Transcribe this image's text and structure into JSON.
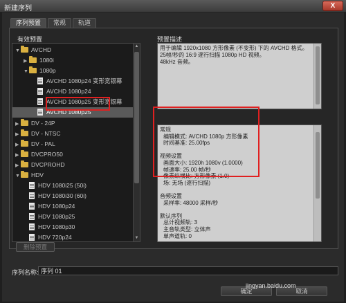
{
  "window": {
    "title": "新建序列",
    "close_label": "X"
  },
  "tabs": [
    {
      "label": "序列预置",
      "active": true
    },
    {
      "label": "常规",
      "active": false
    },
    {
      "label": "轨道",
      "active": false
    }
  ],
  "presets": {
    "heading": "有效预置",
    "items": [
      {
        "label": "AVCHD",
        "type": "folder",
        "expanded": true,
        "level": 0
      },
      {
        "label": "1080i",
        "type": "folder",
        "expanded": false,
        "level": 1
      },
      {
        "label": "1080p",
        "type": "folder",
        "expanded": true,
        "level": 1
      },
      {
        "label": "AVCHD 1080p24 变形宽银幕",
        "type": "file",
        "level": 2
      },
      {
        "label": "AVCHD 1080p24",
        "type": "file",
        "level": 2
      },
      {
        "label": "AVCHD 1080p25 变形宽银幕",
        "type": "file",
        "level": 2
      },
      {
        "label": "AVCHD 1080p25",
        "type": "file",
        "level": 2,
        "selected": true
      },
      {
        "label": "DV - 24P",
        "type": "folder",
        "expanded": false,
        "level": 0
      },
      {
        "label": "DV - NTSC",
        "type": "folder",
        "expanded": false,
        "level": 0
      },
      {
        "label": "DV - PAL",
        "type": "folder",
        "expanded": false,
        "level": 0
      },
      {
        "label": "DVCPRO50",
        "type": "folder",
        "expanded": false,
        "level": 0
      },
      {
        "label": "DVCPROHD",
        "type": "folder",
        "expanded": false,
        "level": 0
      },
      {
        "label": "HDV",
        "type": "folder",
        "expanded": true,
        "level": 0
      },
      {
        "label": "HDV 1080i25 (50i)",
        "type": "file",
        "level": 1
      },
      {
        "label": "HDV 1080i30 (60i)",
        "type": "file",
        "level": 1
      },
      {
        "label": "HDV 1080p24",
        "type": "file",
        "level": 1
      },
      {
        "label": "HDV 1080p25",
        "type": "file",
        "level": 1
      },
      {
        "label": "HDV 1080p30",
        "type": "file",
        "level": 1
      },
      {
        "label": "HDV 720p24",
        "type": "file",
        "level": 1
      }
    ]
  },
  "description": {
    "heading": "预置描述",
    "lines": [
      "用于编辑 1920x1080 方形像素 (不变形) 下的 AVCHD 格式。",
      "25帧/秒的 16:9 逐行扫描 1080p HD 视频。",
      "48kHz 音频。"
    ]
  },
  "details": {
    "lines": [
      {
        "text": "常规",
        "indent": false
      },
      {
        "text": "编辑模式: AVCHD 1080p 方形像素",
        "indent": true
      },
      {
        "text": "时间基准: 25.00fps",
        "indent": true
      },
      {
        "text": "",
        "indent": false
      },
      {
        "text": "视频设置",
        "indent": false
      },
      {
        "text": "画面大小: 1920h 1080v (1.0000)",
        "indent": true
      },
      {
        "text": "帧速率: 25.00 帧/秒",
        "indent": true
      },
      {
        "text": "像素纵横比: 方形像素 (1.0)",
        "indent": true
      },
      {
        "text": "场: 无场 (逐行扫描)",
        "indent": true
      },
      {
        "text": "",
        "indent": false
      },
      {
        "text": "音频设置",
        "indent": false
      },
      {
        "text": "采样率: 48000 采样/秒",
        "indent": true
      },
      {
        "text": "",
        "indent": false
      },
      {
        "text": "默认序列",
        "indent": false
      },
      {
        "text": "总计视频轨: 3",
        "indent": true
      },
      {
        "text": "主音轨类型: 立体声",
        "indent": true
      },
      {
        "text": "单声道轨: 0",
        "indent": true
      }
    ]
  },
  "buttons": {
    "delete_preset": "删除预置",
    "ok": "确定",
    "cancel": "取消"
  },
  "sequence_name": {
    "label": "序列名称:",
    "value": "序列 01"
  },
  "watermark": "jingyan.baidu.com",
  "colors": {
    "highlight": "#e02020",
    "folder": "#d9b040"
  }
}
